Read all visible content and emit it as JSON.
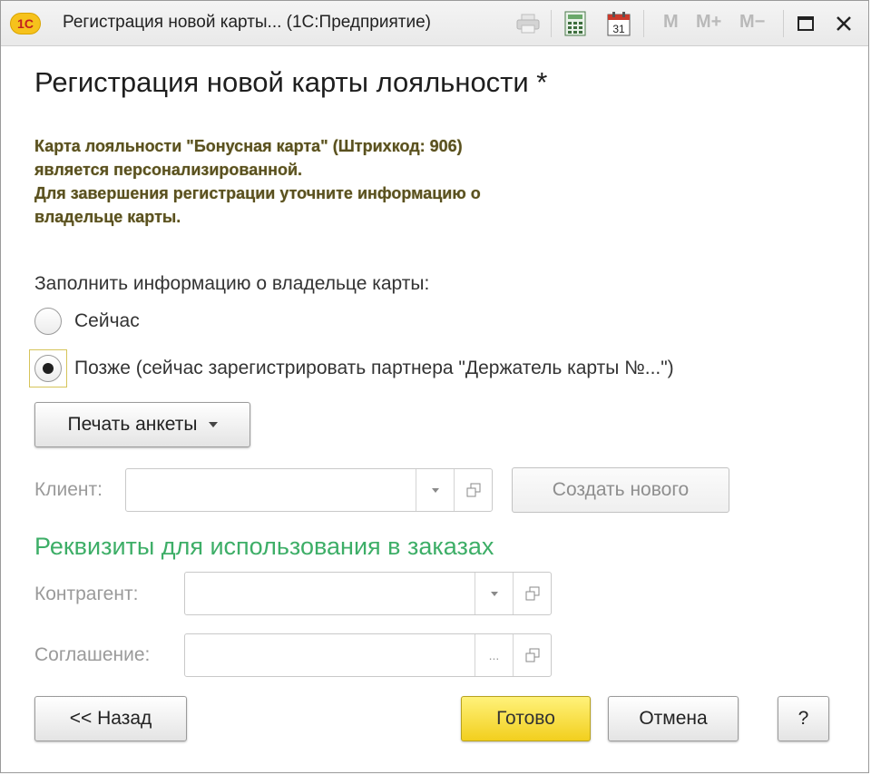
{
  "window": {
    "title": "Регистрация новой карты... (1С:Предприятие)",
    "logo_text": "1С",
    "toolbar": {
      "m": "M",
      "m_plus": "M+",
      "m_minus": "M−",
      "calendar_day": "31"
    }
  },
  "form": {
    "heading": "Регистрация новой карты лояльности *",
    "notice": [
      "Карта лояльности \"Бонусная карта\" (Штрихкод: 906)",
      "является персонализированной.",
      "Для завершения регистрации уточните информацию о",
      "владельце карты."
    ],
    "fill_label": "Заполнить информацию о владельце карты:",
    "radio_options": [
      {
        "label": "Сейчас",
        "selected": false
      },
      {
        "label": "Позже (сейчас зарегистрировать партнера \"Держатель карты №...\")",
        "selected": true
      }
    ],
    "print_button": "Печать анкеты",
    "client": {
      "label": "Клиент:",
      "value": "",
      "create_button": "Создать нового"
    },
    "section_title": "Реквизиты для использования в заказах",
    "counterparty": {
      "label": "Контрагент:",
      "value": ""
    },
    "agreement": {
      "label": "Соглашение:",
      "value": "",
      "ellipsis": "..."
    }
  },
  "footer": {
    "back_button": "<< Назад",
    "done_button": "Готово",
    "cancel_button": "Отмена",
    "help_button": "?"
  },
  "colors": {
    "accent_yellow": "#f2cf1e",
    "section_green": "#3dae67",
    "notice_text": "#595020"
  }
}
